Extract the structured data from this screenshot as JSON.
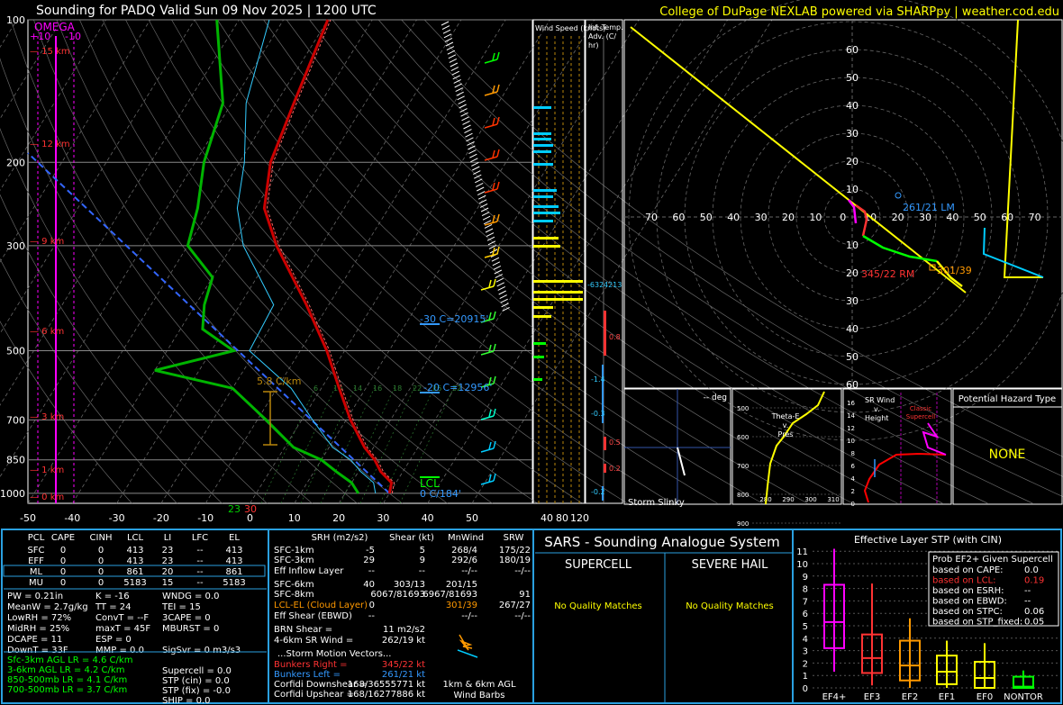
{
  "header": {
    "title": "Sounding for PADQ Valid  Sun 09 Nov 2025 | 1200 UTC",
    "credit": "College of DuPage NEXLAB powered via SHARPpy | weather.cod.edu"
  },
  "colors": {
    "temp": "#cc0000",
    "dewp": "#00b400",
    "wetbulb": "#33ccff",
    "virtual": "#ff4444",
    "parcel": "#3366ff",
    "grid": "#555555",
    "hodo_line": "#ffff00",
    "accent_cyan": "#00ccff",
    "panel_border": "#2aa0e0",
    "yellow": "#ffff00",
    "orange": "#ff9900",
    "magenta": "#ff00ff"
  },
  "skewt": {
    "omega_label": "OMEGA",
    "omega_ticks": [
      "+10",
      "-10"
    ],
    "height_labels": [
      "15 km",
      "12 km",
      "9 km",
      "6 km",
      "3 km",
      "1 km",
      "0 km"
    ],
    "pressure_labels": [
      "100",
      "200",
      "300",
      "500",
      "700",
      "850",
      "1000"
    ],
    "temp_labels": [
      "-50",
      "-40",
      "-30",
      "-20",
      "-10",
      "0",
      "10",
      "20",
      "30",
      "40",
      "50"
    ],
    "annotations": {
      "lapse": "5.8 C/km",
      "wbz": "-30 C=20915'",
      "fz": "-20 C=12956'",
      "lcl": "LCL",
      "sfc_fz": "0 C/184'",
      "sfc_t": "30",
      "sfc_td": "23"
    },
    "mixing_ratio_labels": [
      "6",
      "10",
      "14",
      "16",
      "18",
      "22",
      "26",
      "32"
    ]
  },
  "chart_data": {
    "type": "line",
    "title": "Sounding for PADQ Valid  Sun 09 Nov 2025 | 1200 UTC",
    "xlabel": "",
    "ylabel": "",
    "x_ticks": [
      -50,
      -40,
      -30,
      -20,
      -10,
      0,
      10,
      20,
      30,
      40,
      50
    ],
    "y_ticks_hpa": [
      100,
      200,
      300,
      500,
      700,
      850,
      1000
    ],
    "series": [
      {
        "points": [
          [
            1000,
            30
          ],
          [
            950,
            29
          ],
          [
            900,
            25
          ],
          [
            850,
            22
          ],
          [
            800,
            18
          ],
          [
            700,
            11
          ],
          [
            600,
            4
          ],
          [
            500,
            -4
          ],
          [
            400,
            -15
          ],
          [
            300,
            -30
          ],
          [
            250,
            -38
          ],
          [
            200,
            -43
          ],
          [
            150,
            -46
          ],
          [
            100,
            -50
          ]
        ]
      },
      {
        "points": [
          [
            1000,
            23
          ],
          [
            950,
            20
          ],
          [
            900,
            15
          ],
          [
            850,
            10
          ],
          [
            800,
            2
          ],
          [
            700,
            -8
          ],
          [
            600,
            -20
          ],
          [
            550,
            -40
          ],
          [
            500,
            -25
          ],
          [
            450,
            -35
          ],
          [
            400,
            -38
          ],
          [
            350,
            -40
          ],
          [
            300,
            -50
          ],
          [
            250,
            -53
          ],
          [
            200,
            -58
          ],
          [
            150,
            -62
          ],
          [
            100,
            -75
          ]
        ]
      }
    ]
  },
  "panels": {
    "wind_speed_title": "Wind Speed (knots)",
    "wind_speed_ticks": [
      "40",
      "80",
      "120"
    ],
    "inf_temp_title": "Inf. Temp. Adv. (C/ hr)",
    "inf_temp_values": [
      "0.8",
      "-1.4",
      "-0.3",
      "0.5",
      "0.2",
      "-0.2"
    ],
    "pwat_ticks": [
      "-632",
      "4213"
    ],
    "hodo_rings": [
      "60",
      "50",
      "40",
      "30",
      "20",
      "10",
      "10",
      "20",
      "30",
      "40",
      "50",
      "60"
    ],
    "hodo_x_labels": [
      "70",
      "60",
      "50",
      "40",
      "30",
      "20",
      "10",
      "0",
      "10",
      "20",
      "30",
      "40",
      "50",
      "60",
      "70"
    ],
    "hodo_lm": "261/21 LM",
    "hodo_rm": "345/22 RM",
    "hodo_mean": "301/39",
    "storm_slinky_label": "Storm Slinky",
    "storm_slinky_deg": "-- deg",
    "theta_title": "Theta-E v. Pres",
    "theta_x": [
      "280",
      "290",
      "300",
      "310"
    ],
    "theta_y": [
      "500",
      "600",
      "700",
      "800",
      "900"
    ],
    "srwind_title": "SR Wind v. Height",
    "srwind_y": [
      "16",
      "14",
      "12",
      "10",
      "8",
      "6",
      "4",
      "2",
      "0"
    ],
    "srwind_label": "Classic Supercell",
    "hazard_title": "Potential Hazard Type",
    "hazard_value": "NONE"
  },
  "parcel_table": {
    "headers": [
      "PCL",
      "CAPE",
      "CINH",
      "LCL",
      "LI",
      "LFC",
      "EL"
    ],
    "rows": [
      [
        "SFC",
        "0",
        "0",
        "413",
        "23",
        "--",
        "413"
      ],
      [
        "EFF",
        "0",
        "0",
        "413",
        "23",
        "--",
        "413"
      ],
      [
        "ML",
        "0",
        "0",
        "861",
        "20",
        "--",
        "861"
      ],
      [
        "MU",
        "0",
        "0",
        "5183",
        "15",
        "--",
        "5183"
      ]
    ],
    "misc": [
      [
        "PW = 0.21in",
        "K = -16",
        "WNDG = 0.0"
      ],
      [
        "MeanW = 2.7g/kg",
        "TT = 24",
        "TEI = 15"
      ],
      [
        "LowRH = 72%",
        "ConvT = --F",
        "3CAPE = 0"
      ],
      [
        "MidRH = 25%",
        "maxT = 45F",
        "MBURST = 0"
      ],
      [
        "DCAPE = 11",
        "ESP = 0",
        ""
      ],
      [
        "DownT = 33F",
        "MMP = 0.0",
        "SigSvr = 0 m3/s3"
      ]
    ],
    "lapse_rates": [
      "Sfc-3km AGL LR = 4.6 C/km",
      "3-6km AGL LR = 4.2 C/km",
      "850-500mb LR = 4.1 C/km",
      "700-500mb LR = 3.7 C/km"
    ],
    "indices": [
      "Supercell = 0.0",
      "STP (cin) = 0.0",
      "STP (fix) = -0.0",
      "SHIP = 0.0"
    ]
  },
  "kin_table": {
    "headers": [
      "SRH (m2/s2)",
      "Shear (kt)",
      "MnWind",
      "SRW"
    ],
    "rows": [
      [
        "SFC-1km",
        "-5",
        "5",
        "268/4",
        "175/22"
      ],
      [
        "SFC-3km",
        "29",
        "9",
        "292/6",
        "180/19"
      ],
      [
        "Eff Inflow Layer",
        "--",
        "--",
        "--/--",
        "--/--"
      ],
      [
        "SFC-6km",
        "40",
        "303/13",
        "201/15",
        ""
      ],
      [
        "SFC-8km",
        "",
        "6067/81693",
        "6967/81693",
        "91"
      ],
      [
        "LCL-EL (Cloud Layer)",
        "0",
        "",
        "301/39",
        "267/27"
      ],
      [
        "Eff Shear (EBWD)",
        "--",
        "",
        "--/--",
        "--/--"
      ]
    ],
    "brn": "BRN Shear =",
    "brn_val": "11 m2/s2",
    "sr46": "4-6km SR Wind =",
    "sr46_val": "262/19 kt",
    "storm_vec": "...Storm Motion Vectors...",
    "br_label": "Bunkers Right =",
    "br_val": "345/22 kt",
    "bl_label": "Bunkers Left =",
    "bl_val": "261/21 kt",
    "cd_label": "Corfidi Downshear =",
    "cd_val": "168/36555771 kt",
    "cu_label": "Corfidi Upshear =",
    "cu_val": "168/16277886 kt",
    "barbs_label": "1km & 6km AGL Wind Barbs"
  },
  "sars": {
    "title": "SARS - Sounding Analogue System",
    "supercell": "SUPERCELL",
    "hail": "SEVERE HAIL",
    "sup_msg": "No Quality Matches",
    "hail_msg": "No Quality Matches"
  },
  "stp": {
    "title": "Effective Layer STP (with CIN)",
    "y_ticks": [
      "11",
      "10",
      "9",
      "8",
      "7",
      "6",
      "5",
      "4",
      "3",
      "2",
      "1",
      "0"
    ],
    "categories": [
      "EF4+",
      "EF3",
      "EF2",
      "EF1",
      "EF0",
      "NONTOR"
    ],
    "prob_title": "Prob EF2+ Given Supercell",
    "prob_rows": [
      [
        "based on CAPE:",
        "0.0"
      ],
      [
        "based on LCL:",
        "0.19"
      ],
      [
        "based on ESRH:",
        "--"
      ],
      [
        "based on EBWD:",
        "--"
      ],
      [
        "based on STPC:",
        "0.06"
      ],
      [
        "based on STP_fixed:",
        "0.05"
      ]
    ]
  }
}
